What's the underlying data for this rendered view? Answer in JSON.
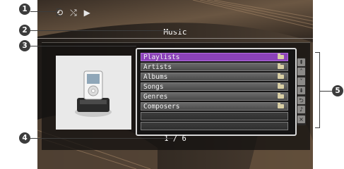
{
  "callouts": [
    "1",
    "2",
    "3",
    "4",
    "5"
  ],
  "status_bar": {
    "icons": [
      "repeat-icon",
      "shuffle-icon",
      "play-icon"
    ],
    "glyphs": [
      "⟲",
      "⤭",
      "▶"
    ]
  },
  "screen": {
    "title": "Music"
  },
  "list": {
    "items": [
      {
        "label": "Playlists",
        "selected": true
      },
      {
        "label": "Artists",
        "selected": false
      },
      {
        "label": "Albums",
        "selected": false
      },
      {
        "label": "Songs",
        "selected": false
      },
      {
        "label": "Genres",
        "selected": false
      },
      {
        "label": "Composers",
        "selected": false
      }
    ]
  },
  "nav_buttons": [
    {
      "name": "page-up-icon",
      "glyph": "⇞"
    },
    {
      "name": "up-icon",
      "glyph": "˄"
    },
    {
      "name": "down-icon",
      "glyph": "˅"
    },
    {
      "name": "page-down-icon",
      "glyph": "⇟"
    },
    {
      "name": "return-icon",
      "glyph": "⮌"
    },
    {
      "name": "music-note-icon",
      "glyph": "♪"
    },
    {
      "name": "close-icon",
      "glyph": "×"
    }
  ],
  "page_counter": "1 / 6",
  "colors": {
    "selected": "#8b42b8",
    "panel": "#151414",
    "callout": "#3c3c3c"
  }
}
